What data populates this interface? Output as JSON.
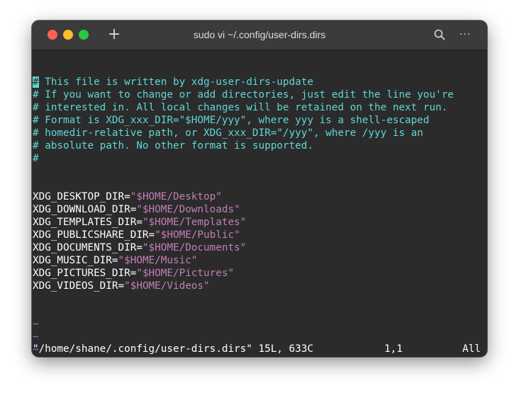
{
  "window": {
    "title": "sudo vi ~/.config/user-dirs.dirs",
    "new_tab_label": "+",
    "more_label": "···",
    "traffic_lights": {
      "close": "#ff5f57",
      "minimize": "#febc2e",
      "maximize": "#28c840"
    }
  },
  "editor": {
    "comments": [
      "# This file is written by xdg-user-dirs-update",
      "# If you want to change or add directories, just edit the line you're",
      "# interested in. All local changes will be retained on the next run.",
      "# Format is XDG_xxx_DIR=\"$HOME/yyy\", where yyy is a shell-escaped",
      "# homedir-relative path, or XDG_xxx_DIR=\"/yyy\", where /yyy is an",
      "# absolute path. No other format is supported.",
      "#"
    ],
    "entries": [
      {
        "key": "XDG_DESKTOP_DIR",
        "value": "\"$HOME/Desktop\""
      },
      {
        "key": "XDG_DOWNLOAD_DIR",
        "value": "\"$HOME/Downloads\""
      },
      {
        "key": "XDG_TEMPLATES_DIR",
        "value": "\"$HOME/Templates\""
      },
      {
        "key": "XDG_PUBLICSHARE_DIR",
        "value": "\"$HOME/Public\""
      },
      {
        "key": "XDG_DOCUMENTS_DIR",
        "value": "\"$HOME/Documents\""
      },
      {
        "key": "XDG_MUSIC_DIR",
        "value": "\"$HOME/Music\""
      },
      {
        "key": "XDG_PICTURES_DIR",
        "value": "\"$HOME/Pictures\""
      },
      {
        "key": "XDG_VIDEOS_DIR",
        "value": "\"$HOME/Videos\""
      }
    ],
    "tilde": "~",
    "empty_line_markers": [
      "~",
      "~",
      "~",
      "~",
      "~",
      "~",
      "~",
      "~"
    ],
    "colors": {
      "comment": "#5fd7d7",
      "string": "#c27fb8",
      "tilde": "#6b8fd6",
      "background": "#2b2b2b"
    }
  },
  "status": {
    "file": "\"/home/shane/.config/user-dirs.dirs\" 15L, 633C",
    "position": "1,1",
    "scroll": "All"
  }
}
